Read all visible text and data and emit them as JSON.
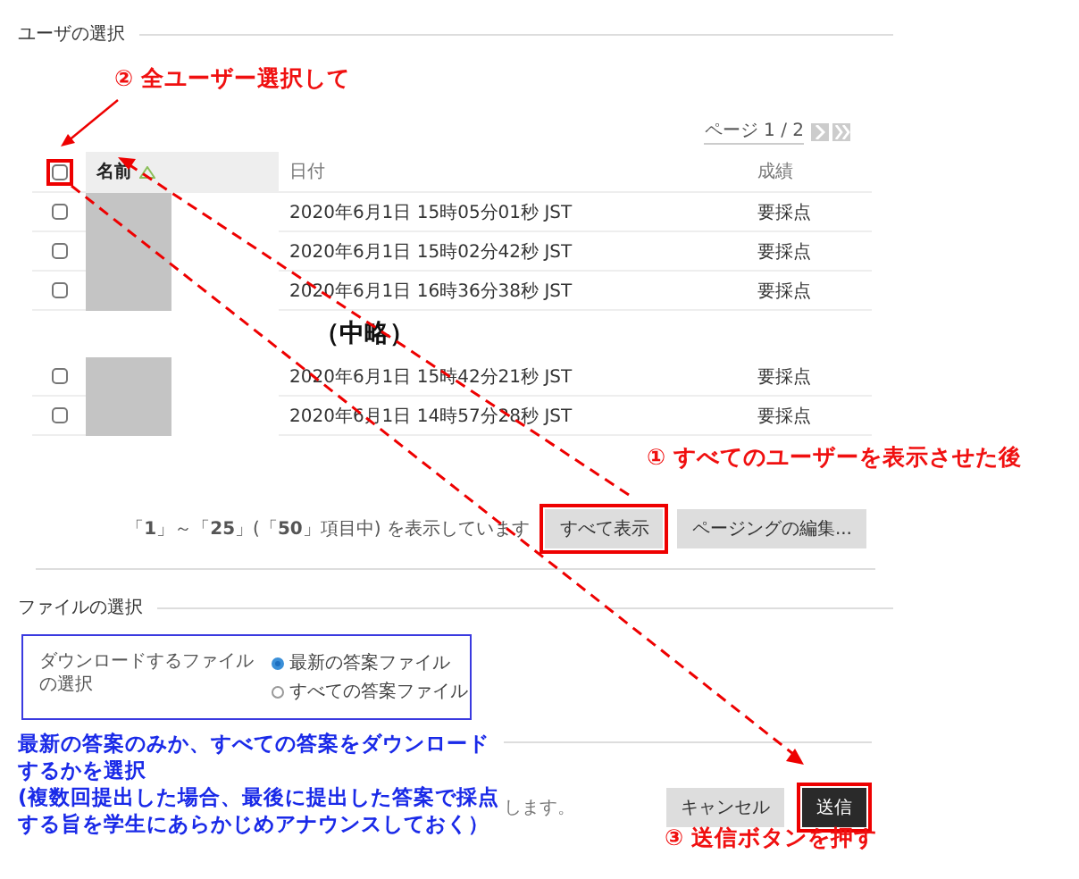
{
  "section_users": {
    "title": "ユーザの選択"
  },
  "pager": {
    "label": "ページ 1 / 2"
  },
  "table": {
    "select_all": {
      "checked": false,
      "highlighted": true
    },
    "columns": [
      {
        "label": "名前",
        "sorted": true
      },
      {
        "label": "日付",
        "sorted": false
      },
      {
        "label": "成績",
        "sorted": false
      }
    ],
    "row_groups": [
      {
        "rows": [
          {
            "checked": false,
            "date": "2020年6月1日 15時05分01秒 JST",
            "grade": "要採点"
          },
          {
            "checked": false,
            "date": "2020年6月1日 15時02分42秒 JST",
            "grade": "要採点"
          },
          {
            "checked": false,
            "date": "2020年6月1日 16時36分38秒 JST",
            "grade": "要採点"
          }
        ]
      },
      {
        "rows": [
          {
            "checked": false,
            "date": "2020年6月1日 15時42分21秒 JST",
            "grade": "要採点"
          },
          {
            "checked": false,
            "date": "2020年6月1日 14時57分28秒 JST",
            "grade": "要採点"
          }
        ]
      }
    ]
  },
  "omission_note": "（中略）",
  "footer": {
    "summary": "「**1**」～「**25**」(「**50**」項目中) を表示しています",
    "buttons": [
      {
        "label": "すべて表示",
        "kind": "secondary",
        "highlighted": true
      },
      {
        "label": "ページングの編集...",
        "kind": "secondary",
        "highlighted": false
      }
    ]
  },
  "section_files": {
    "title": "ファイルの選択",
    "field_label": "ダウンロードするファイルの選択",
    "options": [
      {
        "label": "最新の答案ファイル",
        "selected": true
      },
      {
        "label": "すべての答案ファイル",
        "selected": false
      }
    ]
  },
  "submit_bar": {
    "text": "します。",
    "buttons": [
      {
        "label": "キャンセル",
        "kind": "secondary",
        "highlighted": false
      },
      {
        "label": "送信",
        "kind": "primary",
        "highlighted": true
      }
    ]
  },
  "annotations": [
    {
      "kind": "step",
      "text": "② 全ユーザー選択して"
    },
    {
      "kind": "step",
      "text": "① すべてのユーザーを表示させた後"
    },
    {
      "kind": "step",
      "text": "③ 送信ボタンを押す"
    }
  ],
  "note": {
    "lines": [
      "最新の答案のみか、すべての答案をダウンロードするかを選択",
      "(複数回提出した場合、最後に提出した答案で採点する旨を学生にあらかじめアナウンスしておく）"
    ]
  }
}
